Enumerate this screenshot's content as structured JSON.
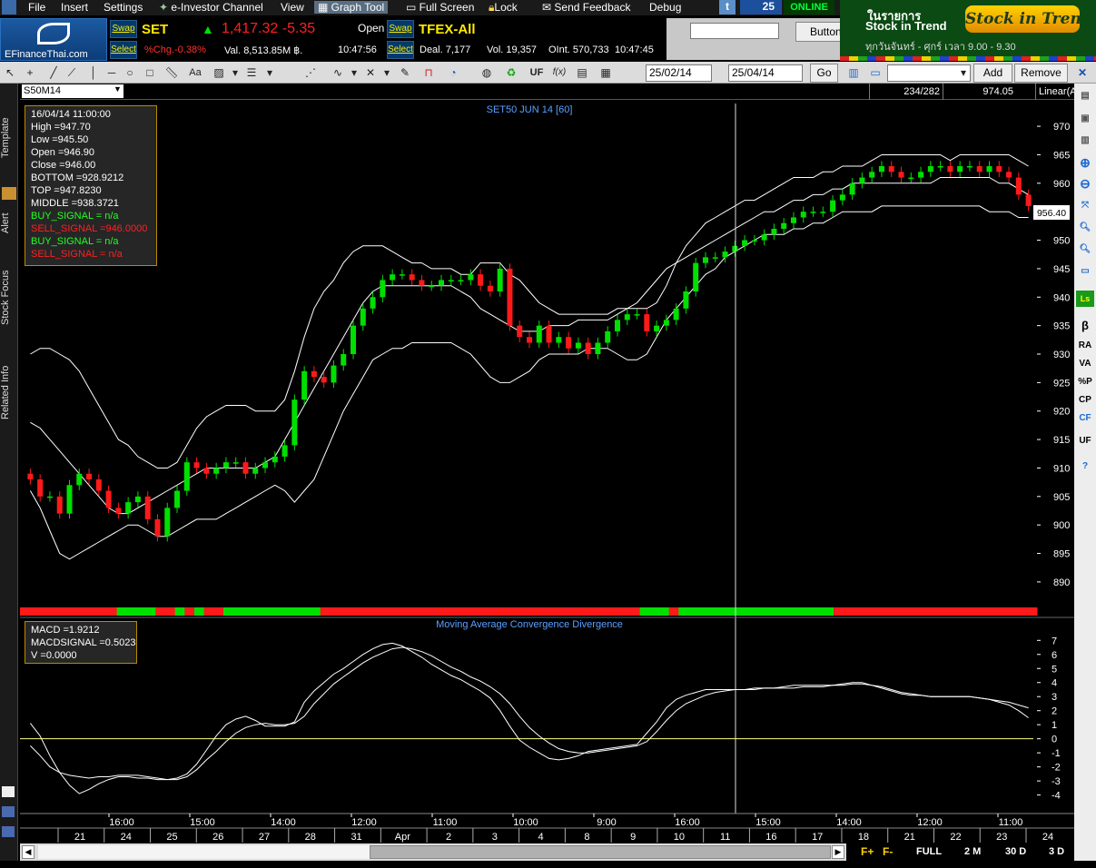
{
  "menu": {
    "items": [
      "File",
      "Insert",
      "Settings",
      "e-Investor Channel",
      "View",
      "Graph Tool",
      "Full Screen",
      "Lock",
      "Send Feedback",
      "Debug"
    ],
    "status_count": "25",
    "status_online": "ONLINE"
  },
  "ticker": {
    "logo_text": "EFinanceThai.com",
    "swap_label": "Swap",
    "select_label": "Select",
    "set": {
      "name": "SET",
      "price": "1,417.32",
      "change": "-5.35",
      "market_state": "Open",
      "pct_chg": "%Chg.-0.38%",
      "value": "Val. 8,513.85M ฿.",
      "time": "10:47:56"
    },
    "tfex": {
      "name": "TFEX-All",
      "deal": "Deal. 7,177",
      "vol": "Vol. 19,357",
      "oint": "OInt. 570,733",
      "time": "10:47:45"
    },
    "search_value": "",
    "button_label": "Button"
  },
  "banner": {
    "line1": "ในรายการ",
    "line2": "Stock in Trend",
    "logo": "Stock in Trend",
    "schedule": "ทุกวันจันทร์ - ศุกร์ เวลา 9.00 - 9.30"
  },
  "toolbar": {
    "date_from": "25/02/14",
    "date_to": "25/04/14",
    "go_label": "Go",
    "add_label": "Add",
    "remove_label": "Remove",
    "aa_label": "Aa",
    "uf_label": "UF",
    "fx_label": "f(x)"
  },
  "chart_header": {
    "symbol": "S50M14",
    "counter": "234/282",
    "price": "974.05",
    "scale_mode": "Linear(Auto)"
  },
  "left_tabs": [
    "Template",
    "Alert",
    "Stock Focus",
    "Related Info"
  ],
  "right_bar": [
    "RA",
    "VA",
    "%P",
    "CP",
    "CF",
    "UF"
  ],
  "info_box": {
    "datetime": "16/04/14 11:00:00",
    "high": "High  =947.70",
    "low": "Low  =945.50",
    "open": "Open  =946.90",
    "close": "Close  =946.00",
    "bottom": "BOTTOM  =928.9212",
    "top": "TOP  =947.8230",
    "middle": "MIDDLE  =938.3721",
    "buy1": "BUY_SIGNAL  = n/a",
    "sell1": "SELL_SIGNAL  =946.0000",
    "buy2": "BUY_SIGNAL  = n/a",
    "sell2": "SELL_SIGNAL  = n/a"
  },
  "macd_box": {
    "macd": "MACD  =1.9212",
    "signal": "MACDSIGNAL  =0.5023",
    "v": "V  =0.0000"
  },
  "bottom_bar": {
    "full": "FULL",
    "m2": "2 M",
    "d30": "30 D",
    "d3": "3 D",
    "fplus": "F+",
    "fminus": "F-"
  },
  "colors": {
    "up": "#00e000",
    "down": "#ff1a1a",
    "band": "#ffffff",
    "axis_text": "#ffffff",
    "title_text": "#5aa0ff"
  },
  "chart_data": [
    {
      "type": "line",
      "title": "SET50 JUN 14  [60]",
      "subtype": "candlestick with bollinger bands",
      "ylim": [
        886,
        974
      ],
      "yticks": [
        890,
        895,
        900,
        905,
        910,
        915,
        920,
        925,
        930,
        935,
        940,
        945,
        950,
        955,
        960,
        965,
        970
      ],
      "last_price_label": "956.40",
      "series": [
        {
          "name": "Close",
          "values": [
            908,
            905,
            905,
            902,
            907,
            909,
            908,
            906,
            903,
            902,
            904,
            905,
            901,
            898,
            903,
            906,
            911,
            910,
            909,
            910,
            911,
            911,
            909,
            910,
            911,
            912,
            914,
            922,
            927,
            926,
            925,
            928,
            930,
            935,
            938,
            940,
            943,
            944,
            944,
            943,
            942,
            942,
            943,
            943,
            943,
            944,
            942,
            941,
            945,
            935,
            933,
            932,
            935,
            932,
            933,
            931,
            932,
            930,
            932,
            934,
            936,
            937,
            937,
            934,
            935,
            936,
            938,
            941,
            946,
            947,
            947,
            948,
            949,
            950,
            950,
            951,
            952,
            953,
            954,
            955,
            955,
            955,
            957,
            958,
            960,
            961,
            962,
            963,
            962,
            961,
            961,
            962,
            963,
            963,
            962,
            963,
            963,
            962,
            963,
            962,
            961,
            958,
            956
          ]
        },
        {
          "name": "TOP",
          "values": [
            930,
            931,
            931,
            930,
            929,
            927,
            924,
            921,
            918,
            915,
            914,
            912,
            911,
            910,
            910,
            911,
            914,
            917,
            919,
            920,
            921,
            921,
            921,
            920,
            920,
            920,
            922,
            927,
            933,
            938,
            941,
            943,
            946,
            948,
            949,
            949,
            949,
            948,
            947,
            946,
            946,
            945,
            945,
            945,
            944,
            944,
            946,
            946,
            946,
            944,
            943,
            941,
            939,
            938,
            937,
            937,
            937,
            937,
            937,
            937,
            938,
            938,
            938,
            938,
            939,
            942,
            946,
            949,
            951,
            953,
            954,
            955,
            956,
            957,
            957,
            958,
            959,
            960,
            961,
            961,
            961,
            962,
            962,
            963,
            963,
            963,
            964,
            965,
            965,
            965,
            965,
            965,
            965,
            965,
            964,
            965,
            965,
            965,
            965,
            965,
            965,
            964,
            963
          ]
        },
        {
          "name": "MIDDLE",
          "values": [
            918,
            917,
            915,
            913,
            911,
            909,
            907,
            905,
            903,
            902,
            902,
            903,
            904,
            905,
            906,
            907,
            908,
            909,
            910,
            910,
            910,
            910,
            910,
            910,
            911,
            912,
            915,
            918,
            921,
            924,
            927,
            930,
            933,
            936,
            939,
            941,
            942,
            942,
            942,
            942,
            942,
            942,
            942,
            942,
            941,
            940,
            938,
            937,
            936,
            935,
            934,
            934,
            934,
            935,
            935,
            935,
            936,
            936,
            936,
            936,
            937,
            938,
            939,
            941,
            943,
            945,
            946,
            947,
            948,
            949,
            950,
            951,
            952,
            953,
            954,
            955,
            955,
            956,
            957,
            957,
            958,
            958,
            959,
            959,
            960,
            960,
            960,
            960,
            960,
            960,
            960,
            960,
            960,
            961,
            961,
            961,
            961,
            961,
            961,
            960,
            960,
            959,
            958
          ]
        },
        {
          "name": "BOTTOM",
          "values": [
            906,
            903,
            899,
            895,
            894,
            895,
            896,
            897,
            898,
            899,
            900,
            900,
            899,
            898,
            898,
            899,
            900,
            901,
            901,
            901,
            902,
            903,
            904,
            905,
            906,
            907,
            906,
            904,
            906,
            908,
            912,
            916,
            920,
            923,
            926,
            929,
            930,
            931,
            931,
            932,
            932,
            932,
            932,
            932,
            931,
            930,
            928,
            926,
            925,
            925,
            926,
            927,
            929,
            930,
            930,
            930,
            930,
            931,
            931,
            931,
            930,
            929,
            929,
            930,
            933,
            936,
            938,
            940,
            942,
            944,
            945,
            947,
            948,
            949,
            950,
            951,
            951,
            951,
            952,
            952,
            953,
            953,
            954,
            955,
            955,
            955,
            955,
            956,
            956,
            956,
            956,
            956,
            956,
            956,
            956,
            956,
            956,
            956,
            955,
            955,
            955,
            954,
            954
          ]
        }
      ]
    },
    {
      "type": "line",
      "title": "Moving Average Convergence Divergence",
      "ylim": [
        -4.8,
        7.6
      ],
      "yticks": [
        -4,
        -3,
        -2,
        -1,
        0,
        1,
        2,
        3,
        4,
        5,
        6,
        7
      ],
      "series": [
        {
          "name": "MACD",
          "values": [
            1.1,
            0.2,
            -1.2,
            -2.4,
            -3.3,
            -3.9,
            -3.6,
            -3.2,
            -2.9,
            -2.7,
            -2.7,
            -2.8,
            -2.8,
            -2.9,
            -2.9,
            -2.8,
            -2.5,
            -1.8,
            -0.8,
            0.2,
            1.0,
            1.4,
            1.6,
            1.3,
            0.9,
            0.9,
            0.9,
            1.2,
            2.6,
            3.4,
            4.0,
            4.6,
            5.0,
            5.5,
            6.0,
            6.4,
            6.7,
            6.8,
            6.6,
            6.2,
            5.8,
            5.3,
            4.9,
            4.5,
            4.2,
            3.8,
            3.4,
            2.9,
            2.0,
            0.9,
            -0.1,
            -0.6,
            -1.0,
            -1.4,
            -1.5,
            -1.4,
            -1.2,
            -0.9,
            -0.8,
            -0.7,
            -0.6,
            -0.5,
            -0.4,
            0.4,
            1.2,
            2.2,
            2.8,
            3.1,
            3.3,
            3.5,
            3.5,
            3.5,
            3.5,
            3.5,
            3.6,
            3.6,
            3.6,
            3.7,
            3.8,
            3.8,
            3.8,
            3.8,
            3.8,
            3.9,
            4.0,
            4.0,
            3.8,
            3.6,
            3.4,
            3.2,
            3.1,
            3.1,
            3.0,
            3.0,
            3.0,
            3.0,
            3.0,
            2.9,
            2.8,
            2.6,
            2.4,
            2.0,
            1.5
          ]
        },
        {
          "name": "MACDSIGNAL",
          "values": [
            -0.5,
            -1.2,
            -2.0,
            -2.4,
            -2.6,
            -2.7,
            -2.8,
            -2.7,
            -2.7,
            -2.6,
            -2.6,
            -2.6,
            -2.7,
            -2.8,
            -2.9,
            -2.9,
            -2.7,
            -2.2,
            -1.5,
            -0.9,
            -0.2,
            0.4,
            0.8,
            1.0,
            1.1,
            1.0,
            1.0,
            1.1,
            1.6,
            2.5,
            3.2,
            3.9,
            4.4,
            4.9,
            5.4,
            5.8,
            6.1,
            6.4,
            6.5,
            6.4,
            6.2,
            5.9,
            5.5,
            5.1,
            4.8,
            4.4,
            4.1,
            3.7,
            3.2,
            2.5,
            1.6,
            0.8,
            0.2,
            -0.3,
            -0.7,
            -0.9,
            -1.0,
            -1.0,
            -0.9,
            -0.8,
            -0.7,
            -0.6,
            -0.5,
            -0.2,
            0.5,
            1.3,
            2.0,
            2.5,
            2.8,
            3.1,
            3.3,
            3.4,
            3.5,
            3.5,
            3.5,
            3.6,
            3.6,
            3.6,
            3.6,
            3.7,
            3.7,
            3.7,
            3.8,
            3.8,
            3.9,
            3.9,
            3.8,
            3.7,
            3.5,
            3.3,
            3.2,
            3.1,
            3.0,
            3.0,
            3.0,
            3.0,
            3.0,
            2.9,
            2.8,
            2.7,
            2.6,
            2.4,
            2.2
          ]
        }
      ]
    }
  ],
  "signal_bar": [
    "red",
    "red",
    "red",
    "red",
    "red",
    "red",
    "red",
    "red",
    "red",
    "red",
    "green",
    "green",
    "green",
    "green",
    "red",
    "red",
    "green",
    "red",
    "green",
    "red",
    "red",
    "green",
    "green",
    "green",
    "green",
    "green",
    "green",
    "green",
    "green",
    "green",
    "green",
    "red",
    "red",
    "red",
    "red",
    "red",
    "red",
    "red",
    "red",
    "red",
    "red",
    "red",
    "red",
    "red",
    "red",
    "red",
    "red",
    "red",
    "red",
    "red",
    "red",
    "red",
    "red",
    "red",
    "red",
    "red",
    "red",
    "red",
    "red",
    "red",
    "red",
    "red",
    "red",
    "red",
    "green",
    "green",
    "green",
    "red",
    "green",
    "green",
    "green",
    "green",
    "green",
    "green",
    "green",
    "green",
    "green",
    "green",
    "green",
    "green",
    "green",
    "green",
    "green",
    "green",
    "red",
    "red",
    "red",
    "red",
    "red",
    "red",
    "red",
    "red",
    "red",
    "red",
    "red",
    "red",
    "red",
    "red",
    "red",
    "red",
    "red",
    "red",
    "red",
    "red",
    "red"
  ],
  "x_axis": {
    "time_labels": [
      "16:00",
      "15:00",
      "14:00",
      "12:00",
      "11:00",
      "10:00",
      "9:00",
      "16:00",
      "15:00",
      "14:00",
      "12:00",
      "11:00"
    ],
    "date_labels": [
      "21",
      "24",
      "25",
      "26",
      "27",
      "28",
      "31",
      "Apr",
      "2",
      "3",
      "4",
      "8",
      "9",
      "10",
      "11",
      "16",
      "17",
      "18",
      "21",
      "22",
      "23",
      "24"
    ]
  }
}
